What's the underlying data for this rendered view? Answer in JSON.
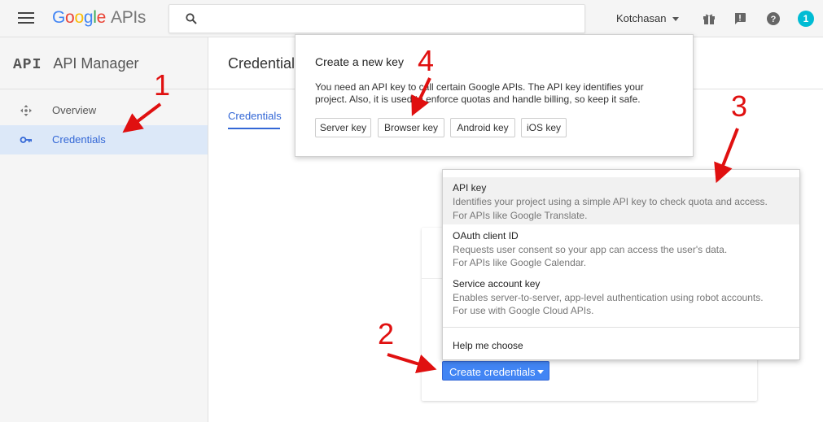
{
  "header": {
    "logo": {
      "g1": "G",
      "g2": "o",
      "g3": "o",
      "g1b": "g",
      "g4": "l",
      "g2b": "e",
      "apis": "APIs"
    },
    "account_name": "Kotchasan",
    "notification_count": "1",
    "icons": [
      "menu-icon",
      "search-icon",
      "gift-icon",
      "feedback-icon",
      "help-icon"
    ]
  },
  "sidebar": {
    "badge": "API",
    "title": "API Manager",
    "items": [
      {
        "label": "Overview",
        "icon": "overview-icon",
        "active": false
      },
      {
        "label": "Credentials",
        "icon": "key-icon",
        "active": true
      }
    ]
  },
  "main": {
    "title": "Credential",
    "tabs": [
      {
        "label": "Credentials"
      }
    ],
    "create_button_label": "Create credentials"
  },
  "key_popup": {
    "title": "Create a new key",
    "description": "You need an API key to call certain Google APIs. The API key identifies your project. Also, it is used to enforce quotas and handle billing, so keep it safe.",
    "buttons": [
      "Server key",
      "Browser key",
      "Android key",
      "iOS key"
    ]
  },
  "credentials_menu": {
    "items": [
      {
        "title": "API key",
        "desc1": "Identifies your project using a simple API key to check quota and access.",
        "desc2": "For APIs like Google Translate."
      },
      {
        "title": "OAuth client ID",
        "desc1": "Requests user consent so your app can access the user's data.",
        "desc2": "For APIs like Google Calendar."
      },
      {
        "title": "Service account key",
        "desc1": "Enables server-to-server, app-level authentication using robot accounts.",
        "desc2": "For use with Google Cloud APIs."
      }
    ],
    "help_label": "Help me choose"
  },
  "annotations": [
    "1",
    "2",
    "3",
    "4"
  ],
  "colors": {
    "accent": "#4285f4",
    "annotation": "#e01010",
    "active_bg": "#dce8f8"
  }
}
